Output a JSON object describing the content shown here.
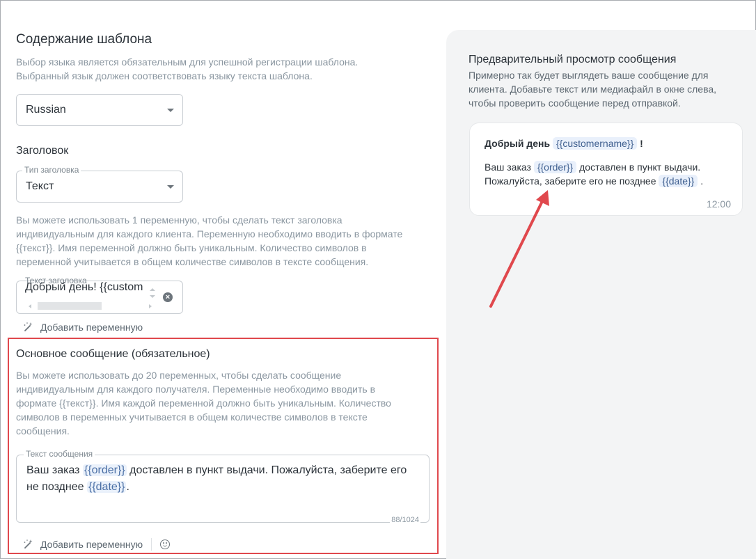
{
  "template": {
    "title": "Содержание шаблона",
    "hint_line1": "Выбор языка является обязательным для успешной регистрации шаблона.",
    "hint_line2": "Выбранный язык должен соответствовать языку текста шаблона.",
    "language_value": "Russian"
  },
  "header": {
    "title": "Заголовок",
    "type_label": "Тип заголовка",
    "type_value": "Текст",
    "hint_line1": "Вы можете использовать 1 переменную, чтобы сделать текст заголовка",
    "hint_line2": "индивидуальным для каждого клиента. Переменную необходимо вводить в формате",
    "hint_line3": "{{текст}}. Имя переменной должно быть уникальным. Количество символов в",
    "hint_line4": "переменной учитывается в общем количестве символов в тексте сообщения.",
    "input_label": "Текст заголовка",
    "input_value": "Добрый день! {{custom",
    "add_variable": "Добавить переменную"
  },
  "body": {
    "title": "Основное сообщение (обязательное)",
    "hint_line1": "Вы можете использовать до 20 переменных, чтобы сделать сообщение",
    "hint_line2": "индивидуальным для каждого получателя. Переменные необходимо вводить в",
    "hint_line3": "формате {{текст}}. Имя каждой переменной должно быть уникальным. Количество",
    "hint_line4": "символов в переменных учитывается в общем количестве символов в тексте",
    "hint_line5": "сообщения.",
    "input_label": "Текст сообщения",
    "text_part1": "Ваш заказ ",
    "var1": "{{order}}",
    "text_part2": " доставлен в пункт выдачи. Пожалуйста, заберите его",
    "text_part3": "не позднее ",
    "var2": "{{date}}",
    "text_part4": ".",
    "counter": "88/1024",
    "add_variable": "Добавить переменную"
  },
  "preview": {
    "title": "Предварительный просмотр сообщения",
    "hint_line1": "Примерно так будет выглядеть ваше сообщение для",
    "hint_line2": "клиента. Добавьте текст или медиафайл в окне слева,",
    "hint_line3": "чтобы проверить сообщение перед отправкой.",
    "head_text": "Добрый день",
    "head_chip": "{{customername}}",
    "head_end": "!",
    "body_part1": "Ваш заказ",
    "body_chip1": "{{order}}",
    "body_part2": "доставлен в пункт выдачи.",
    "body_part3": "Пожалуйста, заберите его не позднее",
    "body_chip2": "{{date}}",
    "body_end": ".",
    "time": "12:00"
  },
  "colors": {
    "highlight": "#e0484d",
    "arrow": "#e0484d",
    "chip_bg": "#e9f0fb",
    "panel_bg": "#f3f4f5"
  }
}
